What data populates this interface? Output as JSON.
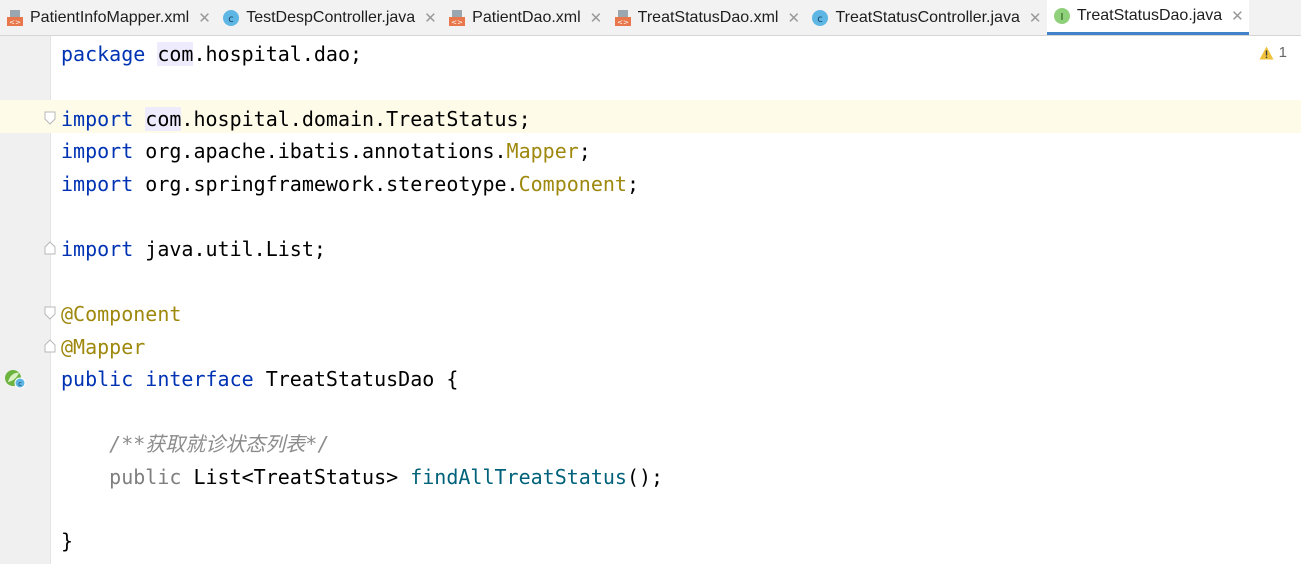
{
  "tabs": [
    {
      "label": "PatientInfoMapper.xml",
      "icon": "xml-file-icon",
      "active": false
    },
    {
      "label": "TestDespController.java",
      "icon": "java-class-icon",
      "active": false
    },
    {
      "label": "PatientDao.xml",
      "icon": "xml-file-icon",
      "active": false
    },
    {
      "label": "TreatStatusDao.xml",
      "icon": "xml-file-icon",
      "active": false
    },
    {
      "label": "TreatStatusController.java",
      "icon": "java-class-icon",
      "active": false
    },
    {
      "label": "TreatStatusDao.java",
      "icon": "java-interface-icon",
      "active": true
    }
  ],
  "tab_close_glyph": "✕",
  "inspections": {
    "warning_count": "1"
  },
  "code": {
    "l1": {
      "kw": "package",
      "pkg_hl": "com",
      "rest": ".hospital.dao;"
    },
    "l3": {
      "kw": "import",
      "hl": "com",
      "rest": ".hospital.domain.TreatStatus;"
    },
    "l4": {
      "kw": "import",
      "rest": "org.apache.ibatis.annotations.",
      "ref": "Mapper",
      "end": ";"
    },
    "l5": {
      "kw": "import",
      "rest": "org.springframework.stereotype.",
      "ref": "Component",
      "end": ";"
    },
    "l7": {
      "kw": "import",
      "rest": "java.util.List;"
    },
    "l9": {
      "ann": "@Component"
    },
    "l10": {
      "ann": "@Mapper"
    },
    "l11": {
      "kw1": "public",
      "kw2": "interface",
      "name": "TreatStatusDao",
      "brace": "{"
    },
    "l13": {
      "comment": "/**获取就诊状态列表*/"
    },
    "l14": {
      "kw": "public",
      "type": "List<TreatStatus>",
      "method": "findAllTreatStatus",
      "end": "();"
    },
    "l16": {
      "brace": "}"
    }
  },
  "colors": {
    "keyword": "#0033b3",
    "annotation": "#9e880d",
    "method": "#00627a",
    "active_tab_underline": "#4083c9"
  }
}
